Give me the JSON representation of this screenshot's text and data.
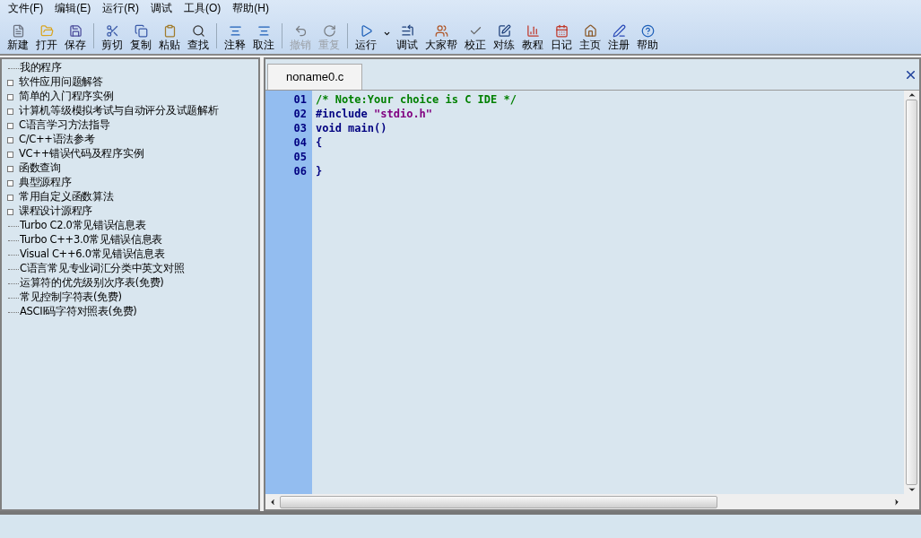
{
  "menu": [
    "文件(F)",
    "编辑(E)",
    "运行(R)",
    "调试",
    "工具(O)",
    "帮助(H)"
  ],
  "toolbar_groups": [
    [
      {
        "label": "新建",
        "disabled": false
      },
      {
        "label": "打开",
        "disabled": false
      },
      {
        "label": "保存",
        "disabled": false
      }
    ],
    [
      {
        "label": "剪切",
        "disabled": false
      },
      {
        "label": "复制",
        "disabled": false
      },
      {
        "label": "粘贴",
        "disabled": false
      },
      {
        "label": "查找",
        "disabled": false
      }
    ],
    [
      {
        "label": "注释",
        "disabled": false
      },
      {
        "label": "取注",
        "disabled": false
      }
    ],
    [
      {
        "label": "撤销",
        "disabled": true
      },
      {
        "label": "重复",
        "disabled": true
      }
    ],
    [
      {
        "label": "运行",
        "disabled": false,
        "dropdown": true
      },
      {
        "label": "调试",
        "disabled": false
      },
      {
        "label": "大家帮",
        "disabled": false
      },
      {
        "label": "校正",
        "disabled": false
      },
      {
        "label": "对练",
        "disabled": false
      },
      {
        "label": "教程",
        "disabled": false
      },
      {
        "label": "日记",
        "disabled": false
      },
      {
        "label": "主页",
        "disabled": false
      },
      {
        "label": "注册",
        "disabled": false
      },
      {
        "label": "帮助",
        "disabled": false
      }
    ]
  ],
  "tree": [
    {
      "label": "我的程序",
      "kind": "leaf"
    },
    {
      "label": "软件应用问题解答",
      "kind": "folder"
    },
    {
      "label": "简单的入门程序实例",
      "kind": "folder"
    },
    {
      "label": "计算机等级模拟考试与自动评分及试题解析",
      "kind": "folder"
    },
    {
      "label": "C语言学习方法指导",
      "kind": "folder"
    },
    {
      "label": "C/C++语法参考",
      "kind": "folder"
    },
    {
      "label": "VC++错误代码及程序实例",
      "kind": "folder"
    },
    {
      "label": "函数查询",
      "kind": "folder"
    },
    {
      "label": "典型源程序",
      "kind": "folder"
    },
    {
      "label": "常用自定义函数算法",
      "kind": "folder"
    },
    {
      "label": "课程设计源程序",
      "kind": "folder"
    },
    {
      "label": "Turbo C2.0常见错误信息表",
      "kind": "leaf"
    },
    {
      "label": "Turbo C++3.0常见错误信息表",
      "kind": "leaf"
    },
    {
      "label": "Visual C++6.0常见错误信息表",
      "kind": "leaf"
    },
    {
      "label": "C语言常见专业词汇分类中英文对照",
      "kind": "leaf"
    },
    {
      "label": "运算符的优先级别次序表(免费)",
      "kind": "leaf"
    },
    {
      "label": "常见控制字符表(免费)",
      "kind": "leaf"
    },
    {
      "label": "ASCII码字符对照表(免费)",
      "kind": "leaf"
    }
  ],
  "editor": {
    "tabs": [
      {
        "label": "noname0.c",
        "selected": true
      }
    ],
    "lines": [
      {
        "number": "01",
        "tokens": [
          {
            "text": "/* Note:Your choice is C IDE */",
            "kind": "comment"
          }
        ]
      },
      {
        "number": "02",
        "tokens": [
          {
            "text": "#include ",
            "kind": "preprocessor"
          },
          {
            "text": "\"stdio.h\"",
            "kind": "string"
          }
        ]
      },
      {
        "number": "03",
        "tokens": [
          {
            "text": "void main()",
            "kind": "plain"
          }
        ]
      },
      {
        "number": "04",
        "tokens": [
          {
            "text": "{",
            "kind": "plain"
          }
        ]
      },
      {
        "number": "05"
      },
      {
        "number": "06",
        "tokens": [
          {
            "text": "}",
            "kind": "plain"
          }
        ]
      }
    ]
  }
}
